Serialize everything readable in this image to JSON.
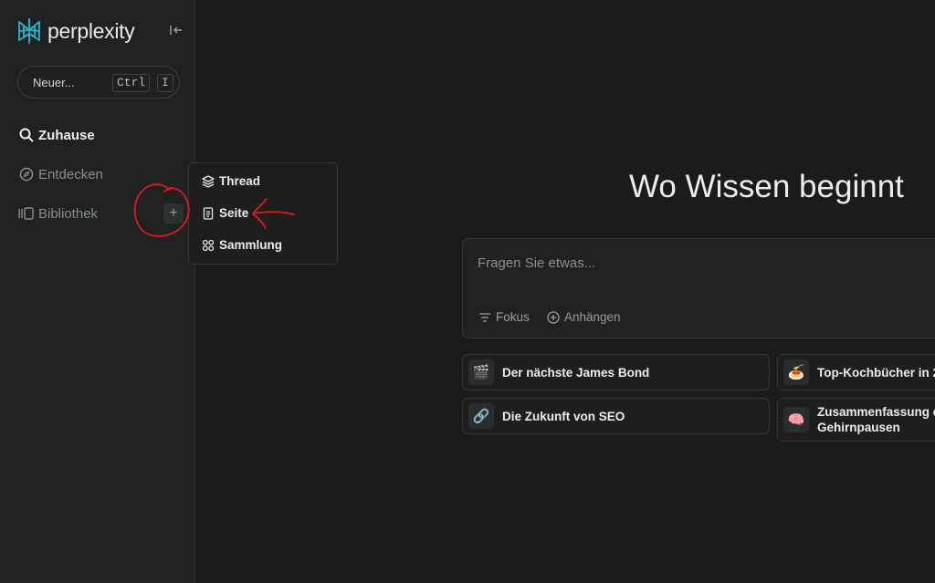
{
  "sidebar": {
    "brand": "perplexity",
    "new_thread": {
      "label": "Neuer...",
      "kbd1": "Ctrl",
      "kbd2": "I"
    },
    "items": [
      {
        "label": "Zuhause",
        "icon": "search-icon"
      },
      {
        "label": "Entdecken",
        "icon": "compass-icon"
      },
      {
        "label": "Bibliothek",
        "icon": "library-icon"
      }
    ],
    "plus": "+"
  },
  "create_menu": {
    "items": [
      {
        "label": "Thread",
        "icon": "layers-icon"
      },
      {
        "label": "Seite",
        "icon": "page-icon"
      },
      {
        "label": "Sammlung",
        "icon": "grid-icon"
      }
    ]
  },
  "main": {
    "title": "Wo Wissen beginnt",
    "ask": {
      "placeholder": "Fragen Sie etwas...",
      "focus_label": "Fokus",
      "attach_label": "Anhängen"
    },
    "suggestions": [
      {
        "emoji": "🎬",
        "text": "Der nächste James Bond"
      },
      {
        "emoji": "🍝",
        "text": "Top-Kochbücher in 2"
      },
      {
        "emoji": "🔗",
        "text": "Die Zukunft von SEO"
      },
      {
        "emoji": "🧠",
        "text_line1": "Zusammenfassung d",
        "text_line2": "Gehirnpausen"
      }
    ]
  },
  "colors": {
    "accent": "#20b8cd",
    "annotation": "#e0191e",
    "background": "#1b1b1b"
  }
}
